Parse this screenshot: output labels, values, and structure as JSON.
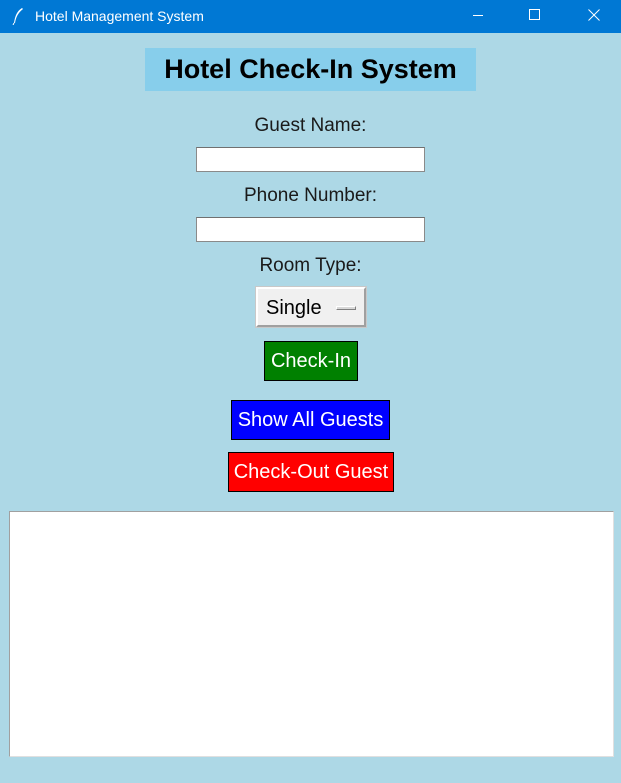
{
  "window": {
    "title": "Hotel Management System",
    "icon": "feather-icon",
    "controls": [
      "minimize-icon",
      "maximize-icon",
      "close-icon"
    ],
    "background": "#add8e6",
    "titlebar_color": "#0078d4"
  },
  "form": {
    "heading": "Hotel Check-In System",
    "heading_bg": "#87ceeb",
    "guest_name_label": "Guest Name:",
    "guest_name_value": "",
    "phone_label": "Phone Number:",
    "phone_value": "",
    "room_type_label": "Room Type:",
    "room_type_selected": "Single"
  },
  "buttons": {
    "checkin_label": "Check-In",
    "checkin_color": "#008000",
    "show_all_label": "Show All Guests",
    "show_all_color": "#0000ff",
    "checkout_label": "Check-Out Guest",
    "checkout_color": "#ff0000"
  },
  "output": {
    "text": ""
  }
}
